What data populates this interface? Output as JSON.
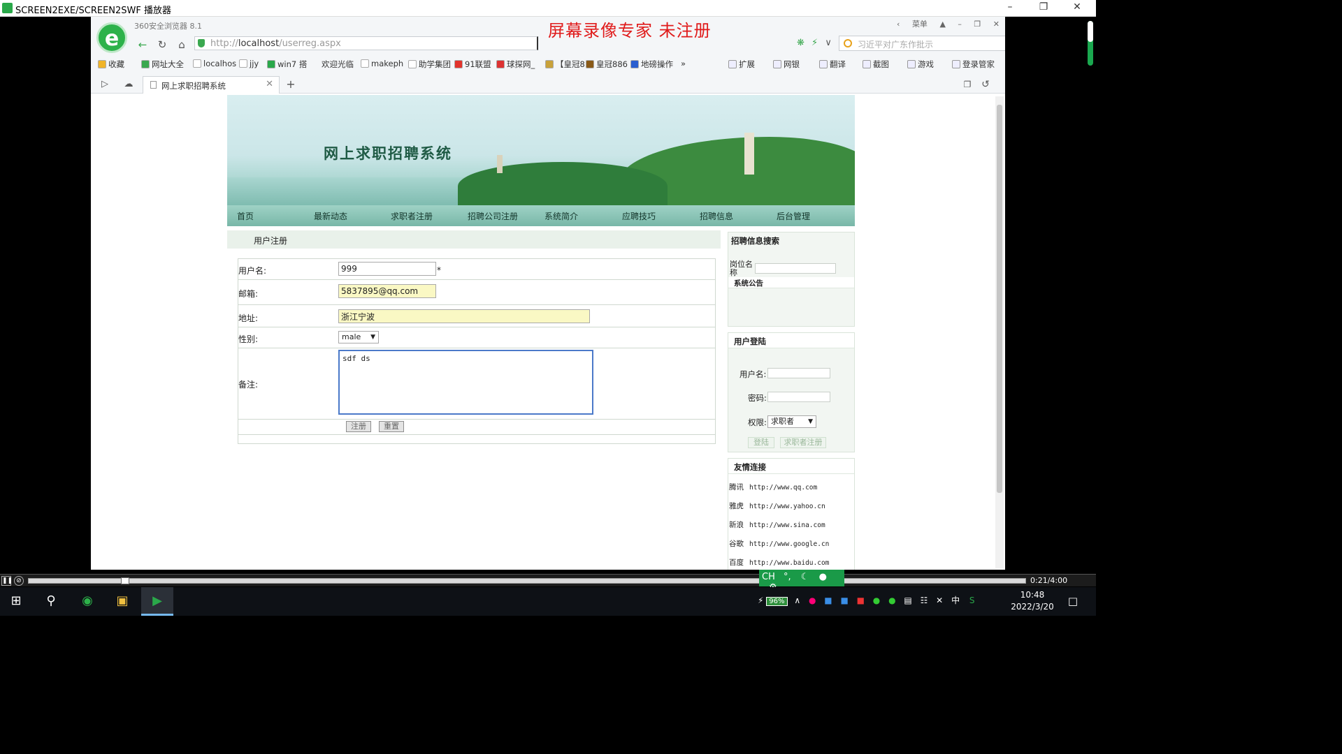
{
  "player": {
    "title": "SCREEN2EXE/SCREEN2SWF 播放器",
    "time": "0:21/4:00"
  },
  "browser": {
    "name": "360安全浏览器 8.1",
    "watermark": "屏幕录像专家  未注册",
    "menu_label": "菜单",
    "url_prefix": "http://",
    "url_host": "localhost",
    "url_path": "/userreg.aspx",
    "search_placeholder": "习近平对广东作批示",
    "favorites": [
      {
        "label": "收藏",
        "color": "#f0b429"
      },
      {
        "label": "网址大全",
        "color": "#3aa84f"
      },
      {
        "label": "localhos",
        "color": "#ffffff"
      },
      {
        "label": "jjy",
        "color": "#ffffff"
      },
      {
        "label": "win7 搭",
        "color": "#2aa84a"
      },
      {
        "label": "欢迎光临",
        "color": ""
      },
      {
        "label": "makeph",
        "color": "#ffffff"
      },
      {
        "label": "助学集团",
        "color": "#ffffff"
      },
      {
        "label": "91联盟",
        "color": "#e2342d"
      },
      {
        "label": "球探网_",
        "color": "#d33"
      },
      {
        "label": "【皇冠8",
        "color": "#c9a23a"
      },
      {
        "label": "皇冠886",
        "color": "#8a5a18"
      },
      {
        "label": "地磅操作",
        "color": "#2b5fd0"
      }
    ],
    "tools": [
      "扩展",
      "网银",
      "翻译",
      "截图",
      "游戏",
      "登录管家"
    ],
    "tab_title": "网上求职招聘系统"
  },
  "site": {
    "banner_title": "网上求职招聘系统",
    "menu": [
      "首页",
      "最新动态",
      "求职者注册",
      "招聘公司注册",
      "系统简介",
      "应聘技巧",
      "招聘信息",
      "后台管理"
    ],
    "section_title": "用户注册",
    "form": {
      "username_label": "用户名:",
      "username_value": "999",
      "required_mark": "*",
      "email_label": "邮箱:",
      "email_value": "5837895@qq.com",
      "address_label": "地址:",
      "address_value": "浙江宁波",
      "gender_label": "性别:",
      "gender_value": "male",
      "note_label": "备注:",
      "note_value": "sdf ds",
      "submit_label": "注册",
      "reset_label": "重置"
    },
    "sidebar": {
      "search_title": "招聘信息搜索",
      "position_label": "岗位名称",
      "notice_title": "系统公告",
      "login_title": "用户登陆",
      "login_user_label": "用户名:",
      "login_pwd_label": "密码:",
      "role_label": "权限:",
      "role_value": "求职者",
      "login_button": "登陆",
      "register_button": "求职者注册",
      "links_title": "友情连接",
      "links": [
        {
          "name": "腾讯",
          "url": "http://www.qq.com"
        },
        {
          "name": "雅虎",
          "url": "http://www.yahoo.cn"
        },
        {
          "name": "新浪",
          "url": "http://www.sina.com"
        },
        {
          "name": "谷歌",
          "url": "http://www.google.cn"
        },
        {
          "name": "百度",
          "url": "http://www.baidu.com"
        }
      ]
    }
  },
  "taskbar": {
    "battery": "96%",
    "ime": "CH",
    "ime_lang": "中",
    "time": "10:48",
    "date": "2022/3/20"
  }
}
